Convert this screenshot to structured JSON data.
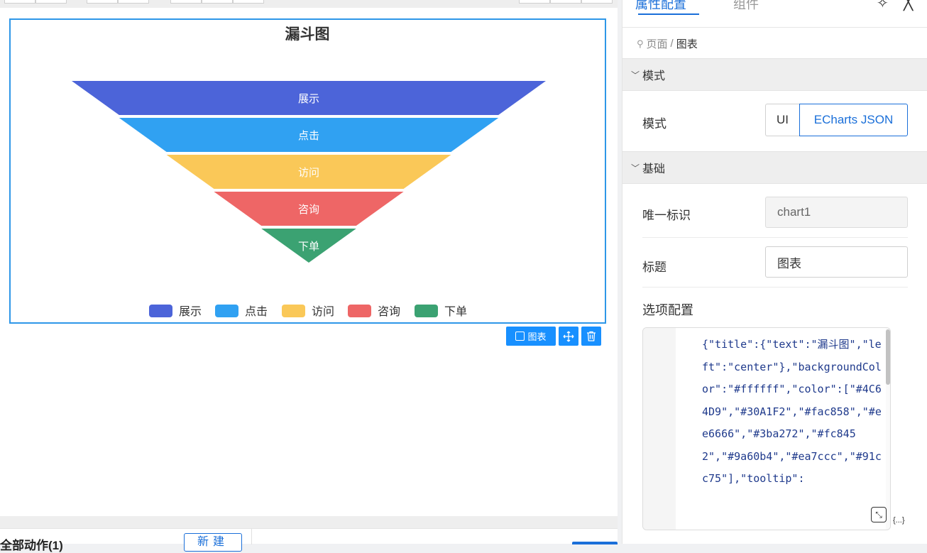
{
  "colors": {
    "accent": "#1a6fd9",
    "selection": "#2e97e8",
    "action_button": "#1890ff"
  },
  "chart_data": {
    "type": "funnel",
    "title": "漏斗图",
    "categories": [
      "展示",
      "点击",
      "访问",
      "咨询",
      "下单"
    ],
    "values": [
      100,
      80,
      60,
      40,
      20
    ],
    "colors": [
      "#4C64D9",
      "#30A1F2",
      "#fac858",
      "#ee6666",
      "#3ba272"
    ],
    "legend": "bottom-center",
    "sort": "descending"
  },
  "chart_toolbar": {
    "chart_label": "图表",
    "move_icon": "move-icon",
    "delete_icon": "trash-icon"
  },
  "bottom": {
    "actions_title": "全部动作(1)",
    "new_label": "新建"
  },
  "panel": {
    "tabs": [
      {
        "label": "属性配置",
        "active": true
      },
      {
        "label": "组件",
        "active": false
      }
    ],
    "pin_icon": "pin-icon",
    "close_icon": "close-icon",
    "breadcrumb": {
      "icon": "location-icon",
      "root": "页面",
      "separator": "/",
      "current": "图表"
    },
    "mode_section": {
      "header": "模式",
      "field_label": "模式",
      "options": [
        "UI",
        "ECharts JSON"
      ],
      "selected": "ECharts JSON"
    },
    "basic_section": {
      "header": "基础",
      "id_label": "唯一标识",
      "id_value": "chart1",
      "title_label": "标题",
      "title_value": "图表",
      "options_label": "选项配置",
      "options_code": "{\"title\":{\"text\":\"漏斗图\",\"left\":\"center\"},\"backgroundColor\":\"#ffffff\",\"color\":[\"#4C64D9\",\"#30A1F2\",\"#fac858\",\"#ee6666\",\"#3ba272\",\"#fc8452\",\"#9a60b4\",\"#ea7ccc\",\"#91cc75\"],\"tooltip\":"
    }
  }
}
